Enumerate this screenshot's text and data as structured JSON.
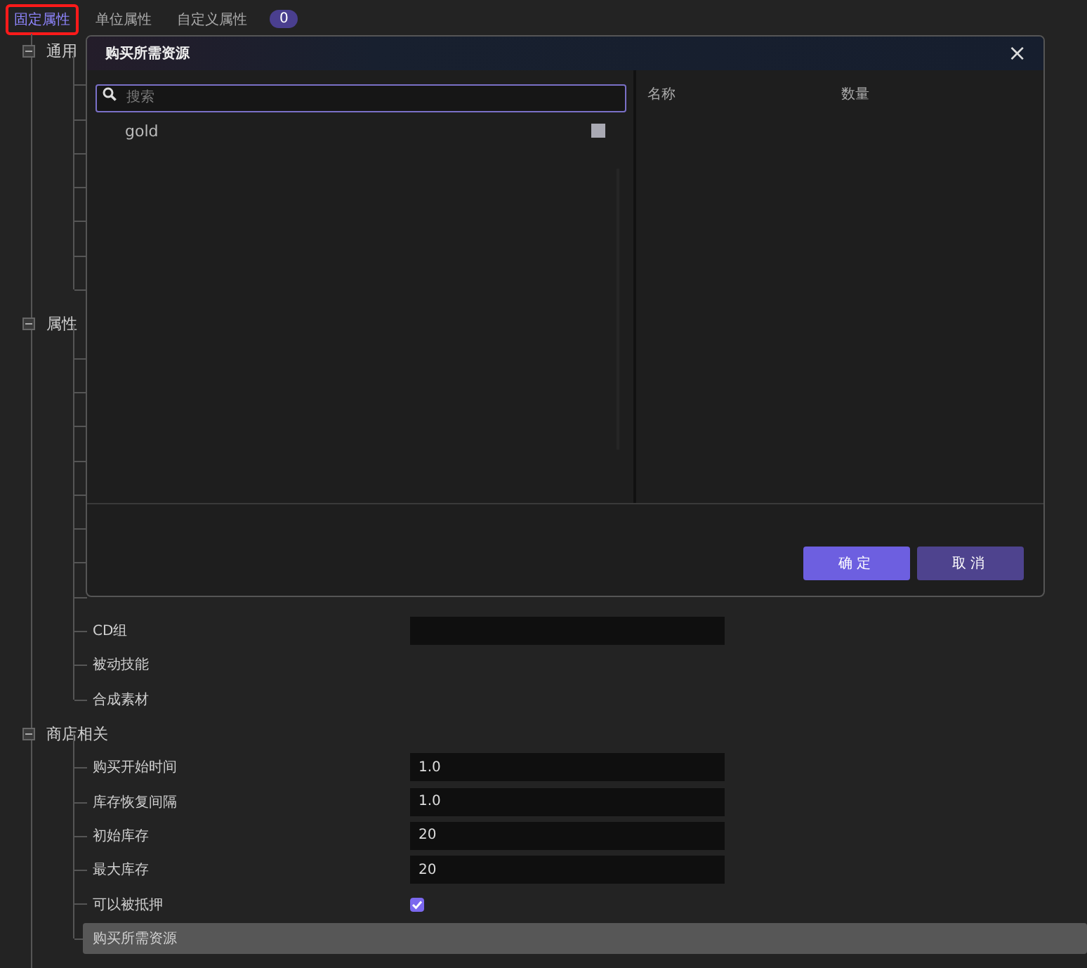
{
  "tabs": [
    {
      "label": "固定属性",
      "selected": true,
      "highlighted": true
    },
    {
      "label": "单位属性",
      "selected": false,
      "highlighted": false
    },
    {
      "label": "自定义属性",
      "selected": false,
      "highlighted": false
    }
  ],
  "tab_badge": "0",
  "groups": [
    {
      "label": "通用",
      "expanded": true
    },
    {
      "label": "属性",
      "expanded": true,
      "children": [
        {
          "label": "CD组",
          "kind": "field"
        },
        {
          "label": "被动技能",
          "kind": "plain"
        },
        {
          "label": "合成素材",
          "kind": "plain"
        }
      ]
    },
    {
      "label": "商店相关",
      "expanded": true,
      "children": [
        {
          "label": "购买开始时间",
          "kind": "field",
          "value": "1.0"
        },
        {
          "label": "库存恢复间隔",
          "kind": "field",
          "value": "1.0"
        },
        {
          "label": "初始库存",
          "kind": "field",
          "value": "20"
        },
        {
          "label": "最大库存",
          "kind": "field",
          "value": "20"
        },
        {
          "label": "可以被抵押",
          "kind": "checkbox",
          "checked": true
        },
        {
          "label": "购买所需资源",
          "kind": "plain",
          "selected": true
        }
      ]
    }
  ],
  "dialog": {
    "title": "购买所需资源",
    "close": "×",
    "search": {
      "placeholder": "搜索"
    },
    "items": [
      {
        "label": "gold",
        "checked": false
      }
    ],
    "columns": [
      "名称",
      "数量"
    ],
    "buttons": [
      {
        "label": "确定",
        "kind": "primary"
      },
      {
        "label": "取消",
        "kind": "secondary"
      }
    ]
  }
}
